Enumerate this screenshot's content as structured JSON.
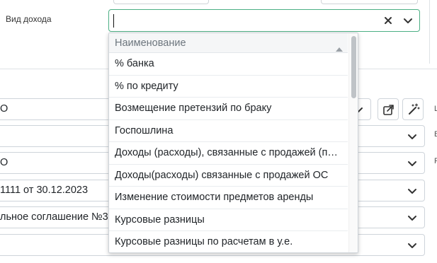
{
  "form": {
    "income_type_label": "Вид дохода",
    "income_type_value": ""
  },
  "background_rows": [
    {
      "text": "О",
      "has_chevron": true
    },
    {
      "text": "",
      "has_chevron": true
    },
    {
      "text": "О",
      "has_chevron": true
    },
    {
      "text": "1111 от 30.12.2023",
      "has_chevron": true
    },
    {
      "text": "льное соглашение №3",
      "has_chevron": true
    },
    {
      "text": "",
      "has_chevron": true
    }
  ],
  "dropdown": {
    "column_header": "Наименование",
    "items": [
      "% банка",
      "% по кредиту",
      "Возмещение претензий по браку",
      "Госпошлина",
      "Доходы (расходы), связанные с продажей (прочее)",
      "Доходы(расходы) связанные с продажей ОС",
      "Изменение стоимости предметов аренды",
      "Курсовые разницы",
      "Курсовые разницы по расчетам в у.е."
    ]
  },
  "icons": {
    "clear": "close-icon",
    "open": "chevron-down-icon",
    "sort": "sort-up-icon",
    "open_card": "open-link-icon",
    "magic": "magic-wand-icon"
  },
  "colors": {
    "focus_border": "#4caf84",
    "scroll_thumb": "#bfc3c7"
  }
}
